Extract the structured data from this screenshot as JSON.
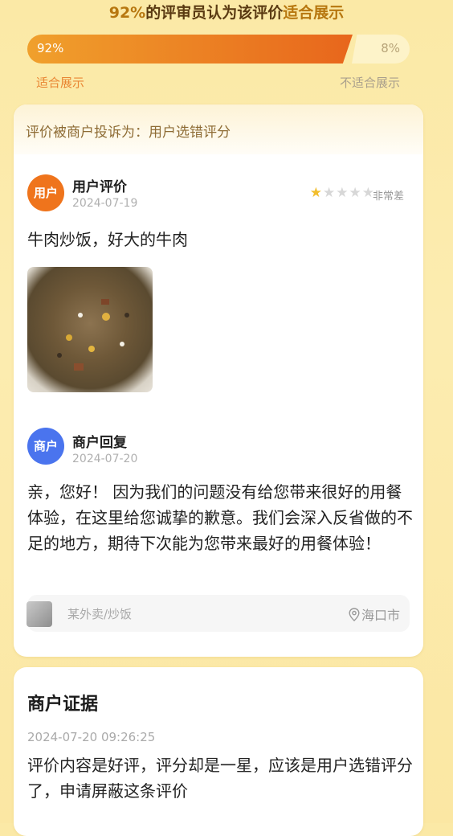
{
  "vote": {
    "headline_pct": "92%",
    "headline_mid": "的评审员认为该评价",
    "headline_end": "适合展示",
    "yes_pct": "92%",
    "yes_fraction": 0.92,
    "no_pct": "8%",
    "yes_label": "适合展示",
    "no_label": "不适合展示",
    "accent": "#e8661c"
  },
  "complaint": {
    "banner": "评价被商户投诉为：用户选错评分"
  },
  "user_review": {
    "avatar": "用户",
    "title": "用户评价",
    "date": "2024-07-19",
    "rating": 1,
    "rating_max": 5,
    "rating_label": "非常差",
    "text": "牛肉炒饭，好大的牛肉"
  },
  "merchant_reply": {
    "avatar": "商户",
    "title": "商户回复",
    "date": "2024-07-20",
    "text": "亲，您好！ 因为我们的问题没有给您带来很好的用餐体验，在这里给您诚挚的歉意。我们会深入反省做的不足的地方，期待下次能为您带来最好的用餐体验！"
  },
  "shop_tag": {
    "name": "某外卖/炒饭",
    "location": "海口市"
  },
  "evidence": {
    "title": "商户证据",
    "datetime": "2024-07-20 09:26:25",
    "text": "评价内容是好评，评分却是一星，应该是用户选错评分了，申请屏蔽这条评价"
  }
}
